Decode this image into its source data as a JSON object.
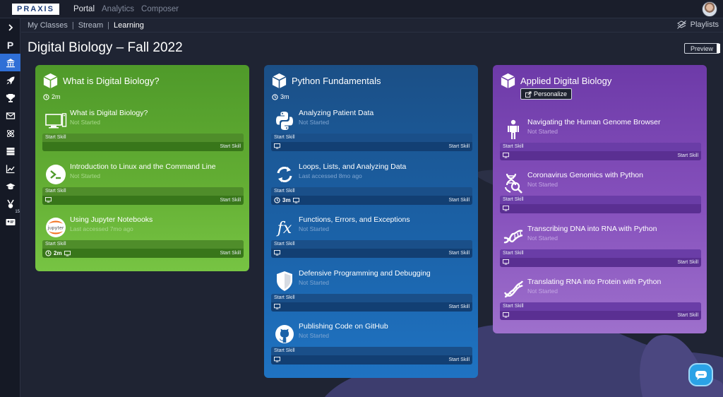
{
  "topbar": {
    "logo": "PRAXIS",
    "nav": [
      {
        "label": "Portal",
        "active": true
      },
      {
        "label": "Analytics",
        "active": false
      },
      {
        "label": "Composer",
        "active": false
      }
    ]
  },
  "sidebar": {
    "items": [
      {
        "icon": "chevron-right-icon"
      },
      {
        "icon": "p-letter-icon",
        "label": "P"
      },
      {
        "icon": "institution-icon",
        "active": true
      },
      {
        "icon": "rocket-icon"
      },
      {
        "icon": "trophy-icon"
      },
      {
        "icon": "envelope-icon"
      },
      {
        "icon": "atom-icon"
      },
      {
        "icon": "server-icon"
      },
      {
        "icon": "chart-line-icon"
      },
      {
        "icon": "graduation-cap-icon"
      },
      {
        "icon": "medal-icon"
      },
      {
        "icon": "id-card-icon",
        "badge": "15"
      }
    ]
  },
  "breadcrumb": {
    "items": [
      "My Classes",
      "Stream",
      "Learning"
    ],
    "separator": "|"
  },
  "playlists_label": "Playlists",
  "page_title": "Digital Biology – Fall 2022",
  "preview_label": "Preview",
  "cards": [
    {
      "title": "What is Digital Biology?",
      "duration": "2m",
      "color": "#5aa52f",
      "skills": [
        {
          "title": "What is Digital Biology?",
          "status": "Not Started",
          "icon": "computer-icon",
          "start": "Start Skill",
          "meta": ""
        },
        {
          "title": "Introduction to Linux and the Command Line",
          "status": "Not Started",
          "icon": "terminal-icon",
          "start": "Start Skill",
          "meta": ""
        },
        {
          "title": "Using Jupyter Notebooks",
          "status": "Last accessed 7mo ago",
          "icon": "jupyter-icon",
          "start": "Start Skill",
          "meta": "2m"
        }
      ]
    },
    {
      "title": "Python Fundamentals",
      "duration": "3m",
      "color": "#1b62a8",
      "skills": [
        {
          "title": "Analyzing Patient Data",
          "status": "Not Started",
          "icon": "python-icon",
          "start": "Start Skill",
          "meta": ""
        },
        {
          "title": "Loops, Lists, and Analyzing Data",
          "status": "Last accessed 8mo ago",
          "icon": "loop-arrows-icon",
          "start": "Start Skill",
          "meta": "3m"
        },
        {
          "title": "Functions, Errors, and Exceptions",
          "status": "Not Started",
          "icon": "function-icon",
          "start": "Start Skill",
          "meta": ""
        },
        {
          "title": "Defensive Programming and Debugging",
          "status": "Not Started",
          "icon": "shield-icon",
          "start": "Start Skill",
          "meta": ""
        },
        {
          "title": "Publishing Code on GitHub",
          "status": "Not Started",
          "icon": "github-icon",
          "start": "Start Skill",
          "meta": ""
        }
      ]
    },
    {
      "title": "Applied Digital Biology",
      "personalize_label": "Personalize",
      "color": "#8752bd",
      "skills": [
        {
          "title": "Navigating the Human Genome Browser",
          "status": "Not Started",
          "icon": "human-body-icon",
          "start": "Start Skill",
          "meta": ""
        },
        {
          "title": "Coronavirus Genomics with Python",
          "status": "Not Started",
          "icon": "dna-search-icon",
          "start": "Start Skill",
          "meta": ""
        },
        {
          "title": "Transcribing DNA into RNA with Python",
          "status": "Not Started",
          "icon": "dna-icon",
          "start": "Start Skill",
          "meta": ""
        },
        {
          "title": "Translating RNA into Protein with Python",
          "status": "Not Started",
          "icon": "dna-strand-icon",
          "start": "Start Skill",
          "meta": ""
        }
      ]
    }
  ]
}
